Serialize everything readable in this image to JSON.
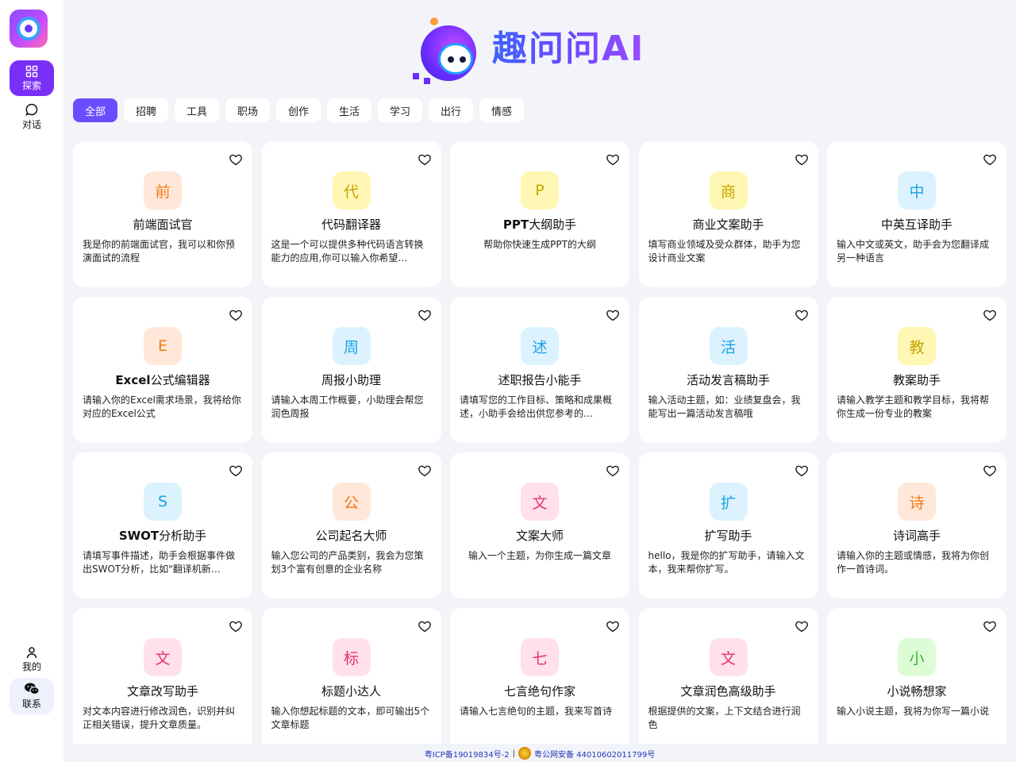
{
  "sidebar": {
    "logo_icon": "app-logo-icon",
    "items": [
      {
        "label": "探索",
        "icon": "grid-icon"
      },
      {
        "label": "对话",
        "icon": "chat-bubble-icon"
      },
      {
        "label": "我的",
        "icon": "user-icon"
      },
      {
        "label": "联系",
        "icon": "wechat-icon"
      }
    ]
  },
  "brand": {
    "text": "趣问问AI"
  },
  "tabs": [
    "全部",
    "招聘",
    "工具",
    "职场",
    "创作",
    "生活",
    "学习",
    "出行",
    "情感"
  ],
  "active_tab": "全部",
  "cards": [
    {
      "badge": "前",
      "title": "前端面试官",
      "desc": "我是你的前端面试官，我可以和你预演面试的流程"
    },
    {
      "badge": "代",
      "title": "代码翻译器",
      "desc": "这是一个可以提供多种代码语言转换能力的应用,你可以输入你希望…"
    },
    {
      "badge": "P",
      "title_bold": "PPT",
      "title_rest": "大纲助手",
      "desc": "帮助你快速生成PPT的大纲"
    },
    {
      "badge": "商",
      "title": "商业文案助手",
      "desc": "填写商业领域及受众群体，助手为您设计商业文案"
    },
    {
      "badge": "中",
      "title": "中英互译助手",
      "desc": "输入中文或英文，助手会为您翻译成另一种语言"
    },
    {
      "badge": "E",
      "title_bold": "Excel",
      "title_rest": "公式编辑器",
      "desc": "请输入你的Excel需求场景，我将给你对应的Excel公式"
    },
    {
      "badge": "周",
      "title": "周报小助理",
      "desc": "请输入本周工作概要，小助理会帮您润色周报"
    },
    {
      "badge": "述",
      "title": "述职报告小能手",
      "desc": "请填写您的工作目标、策略和成果概述，小助手会给出供您参考的…"
    },
    {
      "badge": "活",
      "title": "活动发言稿助手",
      "desc": "输入活动主题，如：业绩复盘会，我能写出一篇活动发言稿哦"
    },
    {
      "badge": "教",
      "title": "教案助手",
      "desc": "请输入教学主题和教学目标，我将帮你生成一份专业的教案"
    },
    {
      "badge": "S",
      "title_bold": "SWOT",
      "title_rest": "分析助手",
      "desc": "请填写事件描述，助手会根据事件做出SWOT分析，比如\"翻译机新…"
    },
    {
      "badge": "公",
      "title": "公司起名大师",
      "desc": "输入您公司的产品类别，我会为您策划3个富有创意的企业名称"
    },
    {
      "badge": "文",
      "title": "文案大师",
      "desc": "输入一个主题，为你生成一篇文章"
    },
    {
      "badge": "扩",
      "title": "扩写助手",
      "desc": "hello，我是你的扩写助手，请输入文本，我来帮你扩写。"
    },
    {
      "badge": "诗",
      "title": "诗词高手",
      "desc": "请输入你的主题或情感，我将为你创作一首诗词。"
    },
    {
      "badge": "文",
      "title": "文章改写助手",
      "desc": "对文本内容进行修改润色，识别并纠正相关错误，提升文章质量。"
    },
    {
      "badge": "标",
      "title": "标题小达人",
      "desc": "输入你想起标题的文本，即可输出5个文章标题"
    },
    {
      "badge": "七",
      "title": "七言绝句作家",
      "desc": "请输入七言绝句的主题，我来写首诗"
    },
    {
      "badge": "文",
      "title": "文章润色高级助手",
      "desc": "根据提供的文案，上下文结合进行润色"
    },
    {
      "badge": "小",
      "title": "小说畅想家",
      "desc": "输入小说主题，我将为你写一篇小说"
    }
  ],
  "footer": {
    "icp": "粤ICP备19019834号-2",
    "separator": "|",
    "police": "粤公网安备 44010602011799号"
  },
  "colors": {
    "accent": "#6b4dff",
    "explore_active": "#7a2ff7",
    "badge_orange_bg": "#ffe8d9",
    "badge_orange_fg": "#f07a16",
    "badge_yellow_bg": "#fff7b3",
    "badge_yellow_fg": "#c8a400",
    "badge_blue_bg": "#dcf3ff",
    "badge_blue_fg": "#1aa0e6",
    "badge_pink_bg": "#ffe0ec",
    "badge_pink_fg": "#e6336e",
    "badge_green_bg": "#ddfcd6",
    "badge_green_fg": "#3bb52a"
  }
}
